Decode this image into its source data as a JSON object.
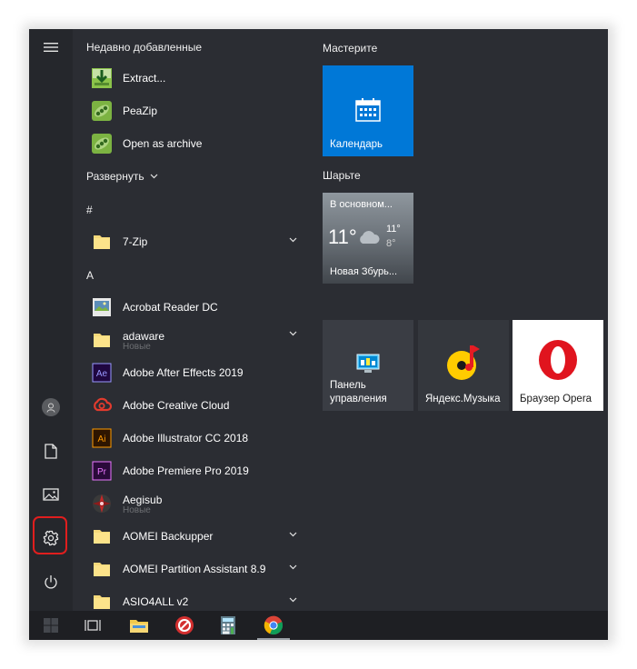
{
  "rail": {
    "menu_icon": "hamburger-icon",
    "items": [
      "user-icon",
      "document-icon",
      "pictures-icon",
      "settings-icon",
      "power-icon"
    ]
  },
  "list": {
    "recent_title": "Недавно добавленные",
    "recent": [
      {
        "name": "Extract...",
        "icon": "extract-icon"
      },
      {
        "name": "PeaZip",
        "icon": "peazip-icon"
      },
      {
        "name": "Open as archive",
        "icon": "peazip-icon"
      }
    ],
    "expand_label": "Развернуть",
    "group_hash": "#",
    "app_7zip": "7-Zip",
    "group_a": "A",
    "acrobat": "Acrobat Reader DC",
    "adaware": "adaware",
    "adaware_sub": "Новые",
    "after_effects": "Adobe After Effects 2019",
    "creative_cloud": "Adobe Creative Cloud",
    "illustrator": "Adobe Illustrator CC 2018",
    "premiere": "Adobe Premiere Pro 2019",
    "aegisub": "Aegisub",
    "aegisub_sub": "Новые",
    "aomei_backupper": "AOMEI Backupper",
    "aomei_partition": "AOMEI Partition Assistant 8.9",
    "asio": "ASIO4ALL v2",
    "ae_badge": "Ae",
    "ai_badge": "Ai",
    "pr_badge": "Pr"
  },
  "tiles": {
    "group1": "Мастерите",
    "calendar": "Календарь",
    "group2": "Шарьте",
    "weather_title": "В основном...",
    "weather_temp": "11°",
    "weather_hi": "11°",
    "weather_lo": "8°",
    "weather_city": "Новая Збурь...",
    "control_panel": "Панель управления",
    "yandex_music": "Яндекс.Музыка",
    "opera": "Браузер Opera"
  },
  "taskbar": {
    "items": [
      "start-icon",
      "task-view-icon",
      "file-explorer-icon",
      "app-red-icon",
      "calculator-icon",
      "chrome-icon"
    ]
  },
  "colors": {
    "panel": "#2b2d33",
    "calendar_tile": "#0078d7",
    "highlight": "#e01e1e"
  }
}
